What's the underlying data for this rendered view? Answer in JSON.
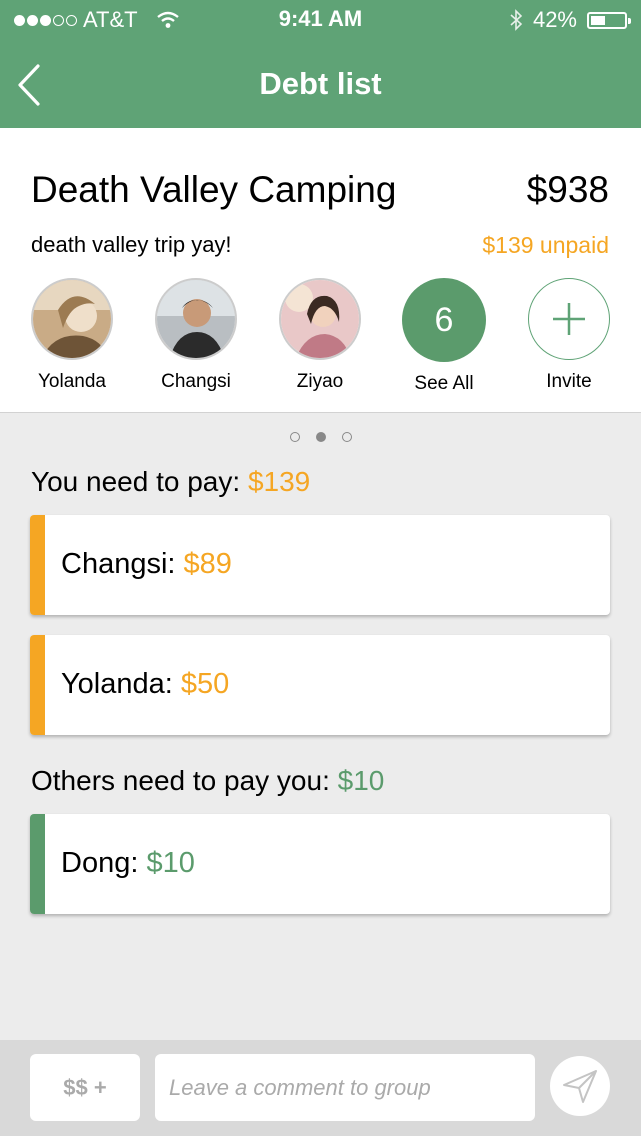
{
  "status_bar": {
    "carrier": "AT&T",
    "time": "9:41 AM",
    "battery": "42%",
    "battery_level": 0.42
  },
  "header": {
    "title": "Debt list",
    "back_icon": "chevron-left-icon"
  },
  "trip": {
    "name": "Death Valley Camping",
    "total": "$938",
    "description": "death valley trip yay!",
    "unpaid": "$139 unpaid"
  },
  "members": [
    {
      "name": "Yolanda"
    },
    {
      "name": "Changsi"
    },
    {
      "name": "Ziyao"
    }
  ],
  "see_all": {
    "count": "6",
    "label": "See All"
  },
  "invite": {
    "label": "Invite",
    "icon": "plus-icon"
  },
  "pager": {
    "pages": 3,
    "active": 2
  },
  "you_pay": {
    "label": "You need to pay: ",
    "amount": "$139",
    "items": [
      {
        "label": "Changsi: ",
        "amount": "$89"
      },
      {
        "label": "Yolanda: ",
        "amount": "$50"
      }
    ]
  },
  "others_pay": {
    "label": "Others need to pay you: ",
    "amount": "$10",
    "items": [
      {
        "label": "Dong: ",
        "amount": "$10"
      }
    ]
  },
  "footer": {
    "money_button": "$$ +",
    "comment_placeholder": "Leave a comment to group",
    "send_icon": "paper-plane-icon"
  },
  "colors": {
    "brand_green": "#5fa376",
    "accent_orange": "#f5a623",
    "debt_green": "#5b9b6c"
  }
}
